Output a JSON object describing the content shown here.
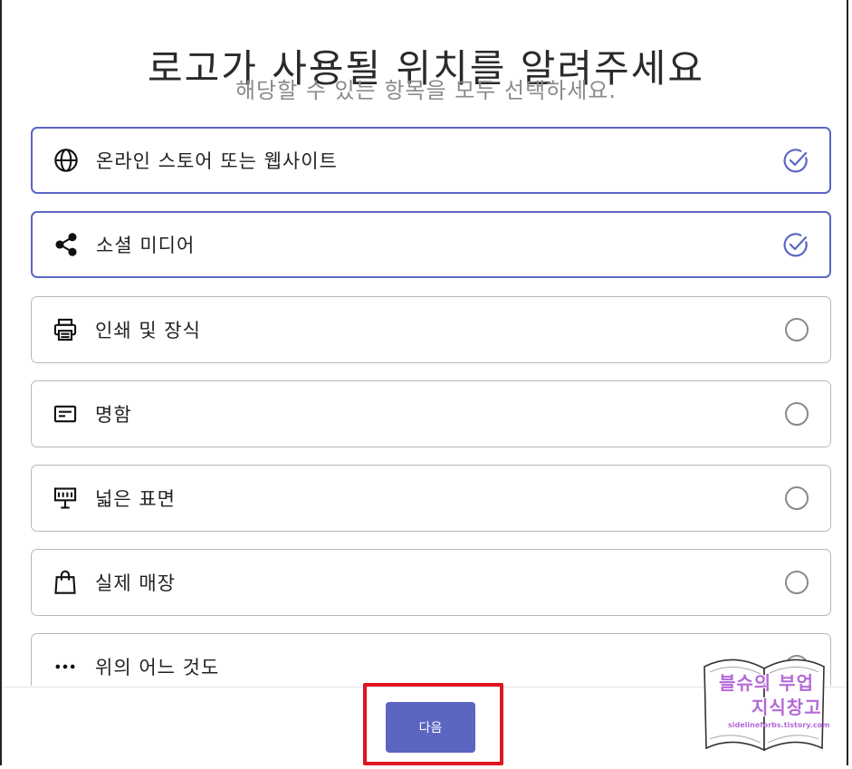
{
  "header": {
    "title": "로고가 사용될 위치를 알려주세요",
    "subtitle": "해당할 수 있는 항목을 모두 선택하세요."
  },
  "options": [
    {
      "label": "온라인 스토어 또는 웹사이트",
      "icon": "globe-icon",
      "selected": true
    },
    {
      "label": "소셜 미디어",
      "icon": "share-icon",
      "selected": true
    },
    {
      "label": "인쇄 및 장식",
      "icon": "printer-icon",
      "selected": false
    },
    {
      "label": "명함",
      "icon": "business-card-icon",
      "selected": false
    },
    {
      "label": "넓은 표면",
      "icon": "billboard-icon",
      "selected": false
    },
    {
      "label": "실제 매장",
      "icon": "shopping-bag-icon",
      "selected": false
    },
    {
      "label": "위의 어느 것도",
      "icon": "more-horizontal-icon",
      "selected": false
    }
  ],
  "footer": {
    "next_label": "다음"
  },
  "watermark": {
    "line1": "블슈의 부업",
    "line2": "지식창고",
    "url": "sidelineforbs.tistory.com"
  },
  "colors": {
    "accent": "#5c65c0",
    "selected_border": "#5b66c4",
    "highlight": "#e0141e",
    "watermark": "#b46ad8"
  }
}
